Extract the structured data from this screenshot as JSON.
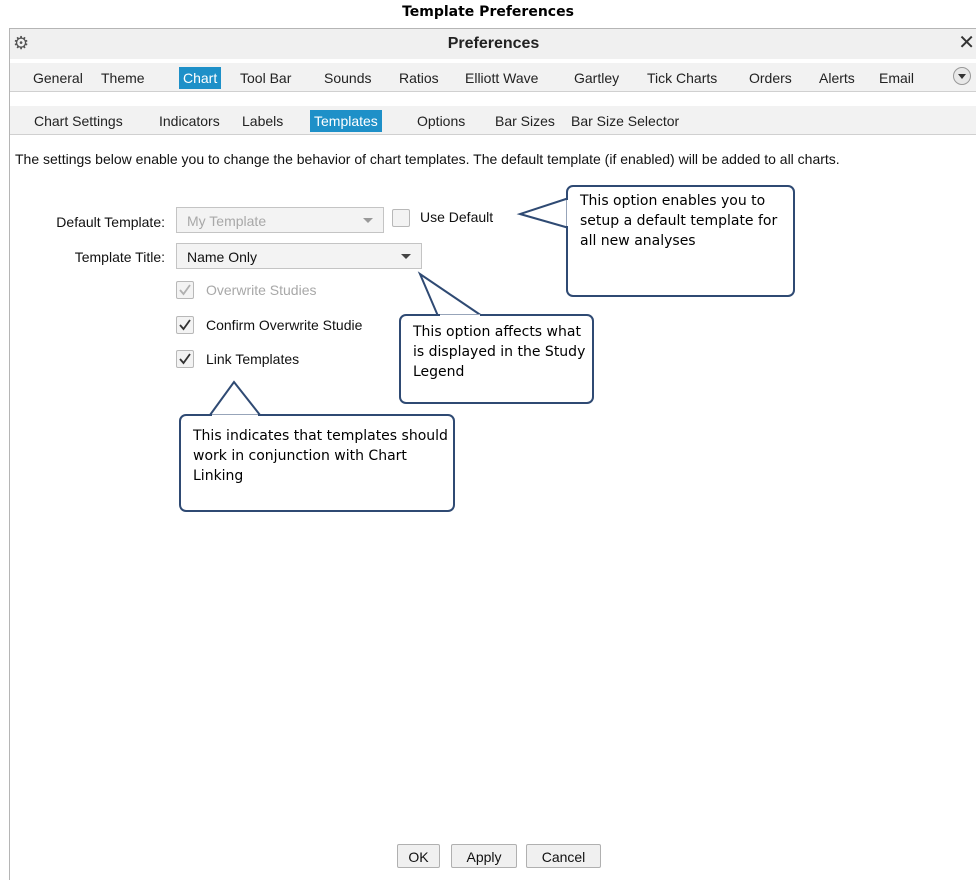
{
  "document_title": "Template Preferences",
  "window": {
    "title": "Preferences",
    "close_symbol": "✕"
  },
  "main_tabs": [
    {
      "label": "General",
      "active": false
    },
    {
      "label": "Theme",
      "active": false
    },
    {
      "label": "Chart",
      "active": true
    },
    {
      "label": "Tool Bar",
      "active": false
    },
    {
      "label": "Sounds",
      "active": false
    },
    {
      "label": "Ratios",
      "active": false
    },
    {
      "label": "Elliott Wave",
      "active": false
    },
    {
      "label": "Gartley",
      "active": false
    },
    {
      "label": "Tick Charts",
      "active": false
    },
    {
      "label": "Orders",
      "active": false
    },
    {
      "label": "Alerts",
      "active": false
    },
    {
      "label": "Email",
      "active": false
    }
  ],
  "sub_tabs": [
    {
      "label": "Chart Settings",
      "active": false
    },
    {
      "label": "Indicators",
      "active": false
    },
    {
      "label": "Labels",
      "active": false
    },
    {
      "label": "Templates",
      "active": true
    },
    {
      "label": "Options",
      "active": false
    },
    {
      "label": "Bar Sizes",
      "active": false
    },
    {
      "label": "Bar Size Selector",
      "active": false
    }
  ],
  "content": {
    "description": "The settings below enable you to change the behavior of chart templates.  The default template (if enabled) will be added to all charts.",
    "default_template": {
      "label": "Default Template:",
      "value": "My Template",
      "enabled": false
    },
    "use_default": {
      "label": "Use Default",
      "checked": false
    },
    "template_title": {
      "label": "Template Title:",
      "value": "Name Only"
    },
    "checkboxes": {
      "overwrite_studies": {
        "label": "Overwrite Studies",
        "checked": true,
        "enabled": false
      },
      "confirm_overwrite": {
        "label": "Confirm Overwrite Studie",
        "checked": true,
        "enabled": true
      },
      "link_templates": {
        "label": "Link Templates",
        "checked": true,
        "enabled": true
      }
    }
  },
  "callouts": {
    "use_default": "This option enables you to setup a default template for all new analyses",
    "template_title": "This option affects what is displayed in the Study Legend",
    "link_templates": "This indicates that templates should work in conjunction with Chart Linking"
  },
  "buttons": {
    "ok": "OK",
    "apply": "Apply",
    "cancel": "Cancel"
  },
  "colors": {
    "accent": "#1e90c8",
    "callout_border": "#2f4a73",
    "disabled_text": "#a8a8a8"
  }
}
